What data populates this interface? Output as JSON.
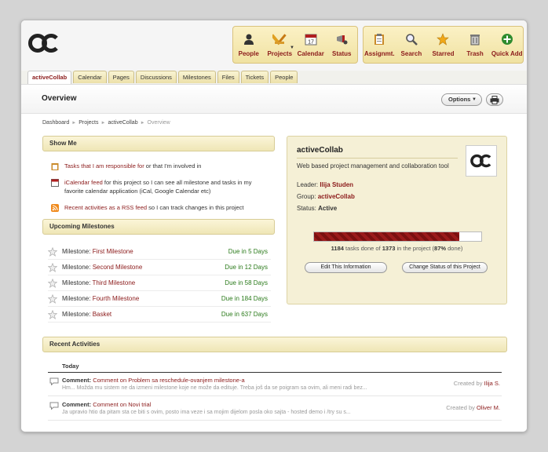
{
  "app": {
    "logo_text": "ac"
  },
  "toolbar_left": [
    {
      "label": "People",
      "icon": "people-icon"
    },
    {
      "label": "Projects",
      "icon": "projects-icon",
      "caret": true
    },
    {
      "label": "Calendar",
      "icon": "calendar-icon",
      "badge": "17"
    },
    {
      "label": "Status",
      "icon": "status-icon"
    }
  ],
  "toolbar_right": [
    {
      "label": "Assignmt.",
      "icon": "assignments-icon"
    },
    {
      "label": "Search",
      "icon": "search-icon"
    },
    {
      "label": "Starred",
      "icon": "star-icon"
    },
    {
      "label": "Trash",
      "icon": "trash-icon"
    },
    {
      "label": "Quick Add",
      "icon": "quick-add-icon"
    }
  ],
  "tabs": [
    "activeCollab",
    "Calendar",
    "Pages",
    "Discussions",
    "Milestones",
    "Files",
    "Tickets",
    "People"
  ],
  "page": {
    "title": "Overview",
    "options_label": "Options"
  },
  "breadcrumb": [
    "Dashboard",
    "Projects",
    "activeCollab",
    "Overview"
  ],
  "show_me": {
    "title": "Show Me",
    "rows": [
      {
        "link": "Tasks that I am responsible for",
        "rest": " or that I'm involved in"
      },
      {
        "link": "iCalendar feed",
        "rest": " for this project so I can see all milestone and tasks in my favorite calendar application (iCal, Google Calendar etc)"
      },
      {
        "link": "Recent activities as a RSS feed",
        "rest": " so I can track changes in this project"
      }
    ]
  },
  "milestones": {
    "title": "Upcoming Milestones",
    "prefix": "Milestone: ",
    "rows": [
      {
        "name": "First Milestone",
        "due": "Due in 5 Days"
      },
      {
        "name": "Second Milestone",
        "due": "Due in 12 Days"
      },
      {
        "name": "Third Milestone",
        "due": "Due in 58 Days"
      },
      {
        "name": "Fourth Milestone",
        "due": "Due in 184 Days"
      },
      {
        "name": "Basket",
        "due": "Due in 637 Days"
      }
    ]
  },
  "project": {
    "name": "activeCollab",
    "description": "Web based project management and collaboration tool",
    "leader_label": "Leader:",
    "leader": "Ilija Studen",
    "group_label": "Group:",
    "group": "activeCollab",
    "status_label": "Status:",
    "status": "Active",
    "tasks_done": "1184",
    "tasks_total": "1373",
    "percent": "87%",
    "progress_fraction": 0.87,
    "progress_mid1": " tasks done of ",
    "progress_mid2": " in the project (",
    "progress_end": " done)",
    "edit_btn": "Edit This Information",
    "status_btn": "Change Status of this Project"
  },
  "recent": {
    "title": "Recent Activities",
    "day": "Today",
    "created_by": "Created by ",
    "rows": [
      {
        "kind": "Comment:",
        "link": "Comment on Problem sa reschedule-ovanjem milestone-a",
        "excerpt": "Hm... Možda mu sistem ne da izmeni milestone koje ne može da edituje. Treba još da se poigram sa ovim, ali meni radi bez...",
        "author": "Ilija S."
      },
      {
        "kind": "Comment:",
        "link": "Comment on Novi trial",
        "excerpt": "Ja upravio htio da pitam sta ce biti s ovim, posto ima veze i sa mojim dijelom posla oko sajta - hosted demo i /try su s...",
        "author": "Oliver M."
      }
    ]
  }
}
